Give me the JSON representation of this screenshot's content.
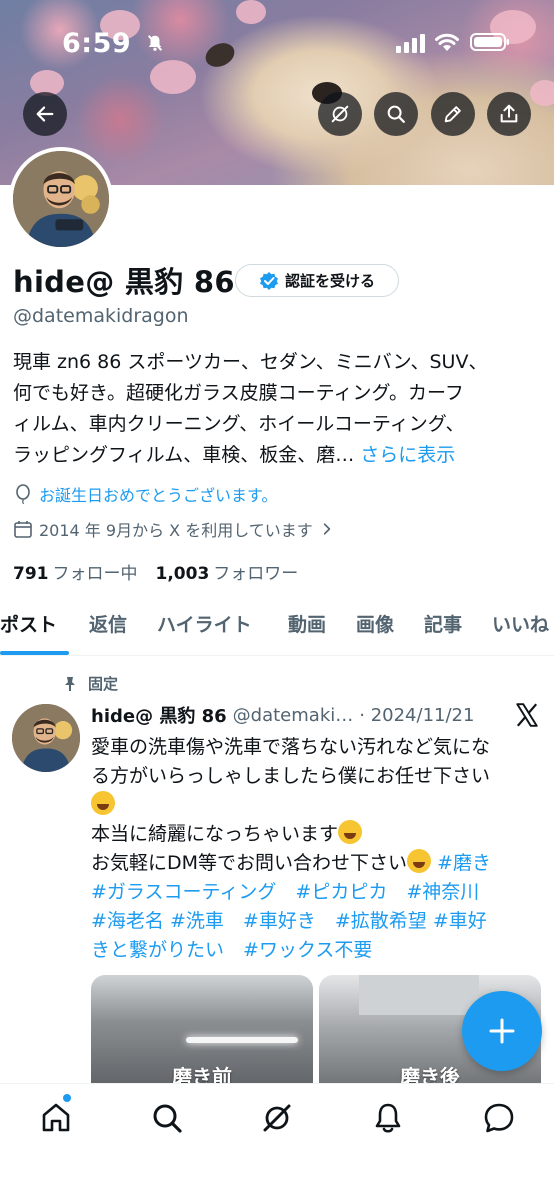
{
  "status_bar": {
    "time": "6:59"
  },
  "banner_buttons": [
    "back-icon",
    "grok-icon",
    "search-icon",
    "edit-icon",
    "share-icon"
  ],
  "profile": {
    "name": "hide@ 黒豹 86",
    "verify_label": "認証を受ける",
    "handle": "@datemakidragon",
    "bio_lines": [
      "現車 zn6 86 スポーツカー、セダン、ミニバン、SUV、",
      "何でも好き。超硬化ガラス皮膜コーティング。カーフ",
      "ィルム、車内クリーニング、ホイールコーティング、",
      "ラッピングフィルム、車検、板金、磨…"
    ],
    "bio_more": "さらに表示",
    "birthday": "お誕生日おめでとうございます。",
    "joined": "2014 年 9月から X を利用しています",
    "following_count": "791",
    "following_label": "フォロー中",
    "followers_count": "1,003",
    "followers_label": "フォロワー"
  },
  "tabs": [
    "ポスト",
    "返信",
    "ハイライト",
    "動画",
    "画像",
    "記事",
    "いいね"
  ],
  "active_tab": "ポスト",
  "post": {
    "pinned_label": "固定",
    "author_name": "hide@ 黒豹 86",
    "author_handle": "@datemaki…",
    "date": "· 2024/11/21",
    "text_line1": "愛車の洗車傷や洗車で落ちない汚れなど気にな",
    "text_line2": "る方がいらっしゃしましたら僕にお任せ下さい",
    "text_line4": "本当に綺麗になっちゃいます",
    "text_line5": "お気軽にDM等でお問い合わせ下さい",
    "tag1": "#磨き",
    "tag2": "#ガラスコーティング",
    "tag3": "#ピカピカ",
    "tag4": "#神奈川",
    "tag5": "#海老名",
    "tag6": "#洗車",
    "tag7": "#車好き",
    "tag8": "#拡散希望",
    "tag9a": "#車好",
    "tag9b": "きと繋がりたい",
    "tag10": "#ワックス不要",
    "media_captions": [
      "磨き前",
      "磨き後"
    ]
  },
  "bottom_nav": [
    "home-icon",
    "search-icon",
    "grok-icon",
    "notifications-icon",
    "messages-icon"
  ],
  "colors": {
    "accent": "#1d9bf0",
    "text": "#0f1419",
    "secondary": "#536471"
  }
}
